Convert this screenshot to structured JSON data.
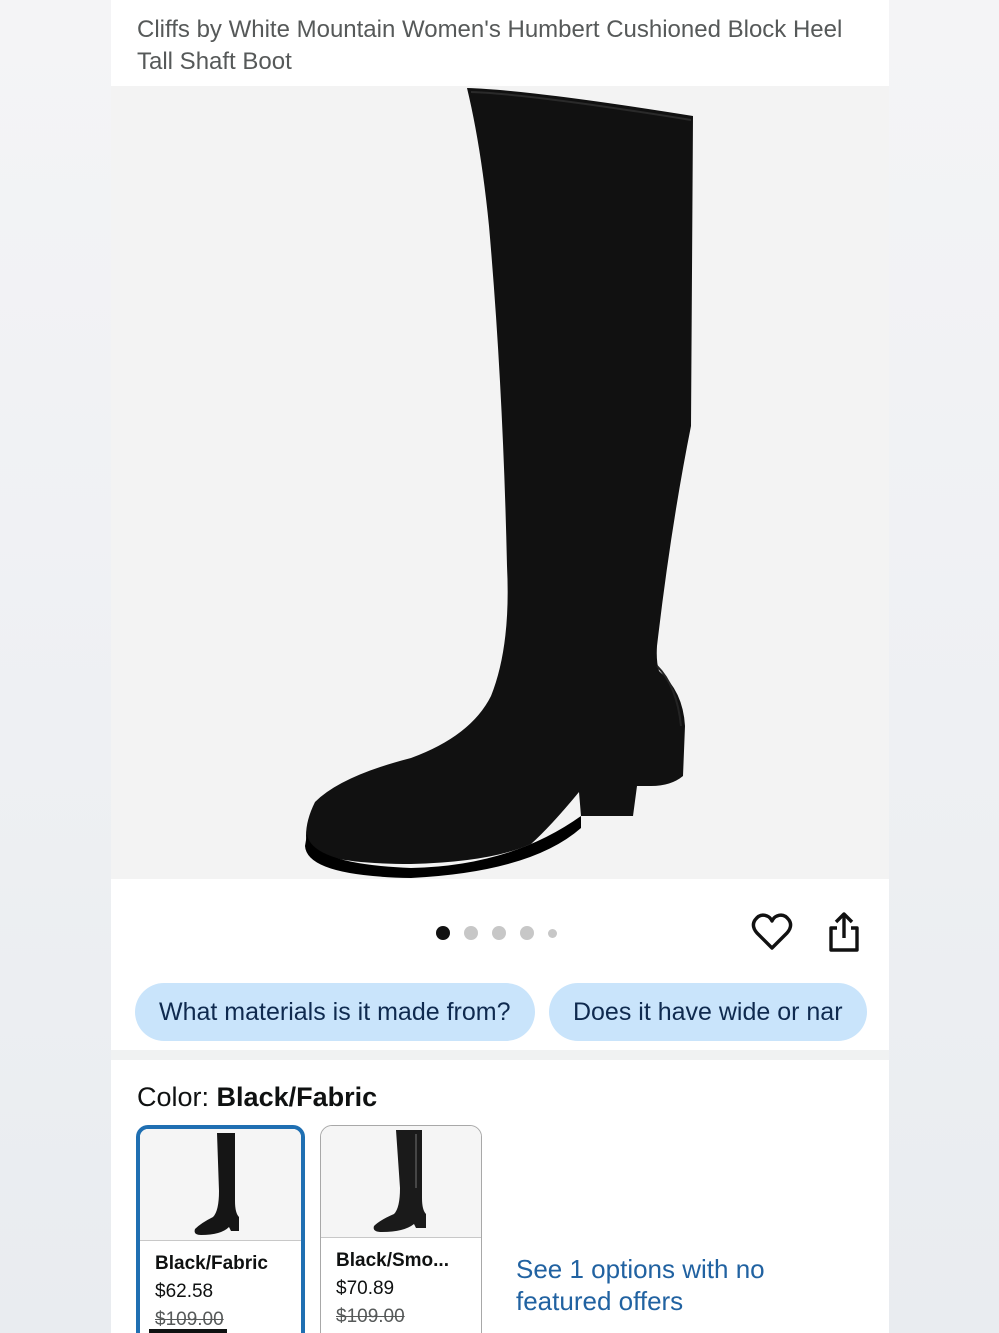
{
  "product": {
    "title": "Cliffs by White Mountain Women's Humbert Cushioned Block Heel Tall Shaft Boot"
  },
  "image_carousel": {
    "total_dots": 5,
    "active_index": 0
  },
  "actions": {
    "favorite_icon": "heart-outline-icon",
    "share_icon": "share-icon"
  },
  "questions": [
    {
      "label": "What materials is it made from?"
    },
    {
      "label": "Does it have wide or nar"
    }
  ],
  "color": {
    "label": "Color:",
    "selected": "Black/Fabric"
  },
  "swatches": [
    {
      "name": "Black/Fabric",
      "price": "$62.58",
      "list_price": "$109.00",
      "selected": true
    },
    {
      "name": "Black/Smo...",
      "price": "$70.89",
      "list_price": "$109.00",
      "selected": false
    }
  ],
  "other_offers": {
    "label": "See 1 options with no featured offers"
  },
  "colors": {
    "accent_blue": "#2162a1",
    "chip_bg": "#c9e4fb",
    "selected_border": "#1f6fb2"
  }
}
